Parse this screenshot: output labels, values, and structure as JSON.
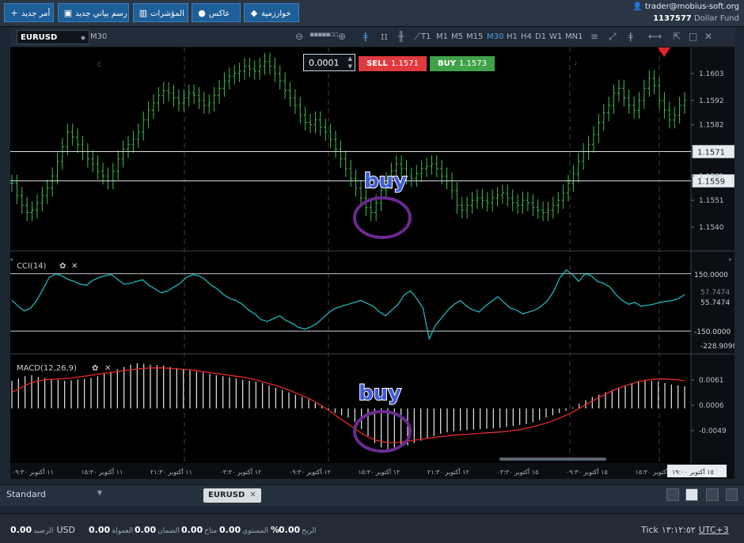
{
  "toolbar": {
    "buttons": [
      {
        "label": "أمر جديد",
        "icon": "plus-icon"
      },
      {
        "label": "رسم بياني جديد",
        "icon": "chart-icon"
      },
      {
        "label": "المؤشرات",
        "icon": "indicators-icon"
      },
      {
        "label": "عاكس",
        "icon": "people-icon"
      },
      {
        "label": "خوارزمية",
        "icon": "diamond-icon"
      }
    ]
  },
  "account": {
    "user": "trader@mobius-soft.org",
    "number": "1137577",
    "currency": "Dollar Fund"
  },
  "chart_header": {
    "symbol": "EURUSD",
    "timeframe": "M30",
    "timeframes": [
      "T1",
      "M1",
      "M5",
      "M15",
      "M30",
      "H1",
      "H4",
      "D1",
      "W1",
      "MN1"
    ],
    "active_timeframe": "M30"
  },
  "trade": {
    "quantity": "0.0001",
    "sell_label": "SELL",
    "sell_price": "1.1571",
    "buy_label": "BUY",
    "buy_price": "1.1573"
  },
  "annotations": {
    "buy1": "buy",
    "buy2": "buy"
  },
  "price_axis": {
    "ticks": [
      "1.1603",
      "1.1592",
      "1.1582",
      "1.1561",
      "1.1551",
      "1.1540"
    ],
    "line_labels": [
      "1.1571",
      "1.1559"
    ]
  },
  "cci": {
    "title": "CCI(14)",
    "levels": [
      "150.0000",
      "-150.0000"
    ],
    "values": [
      "57.7474",
      "55.7474",
      "-228.9098"
    ]
  },
  "macd": {
    "title": "MACD(12,26,9)",
    "ticks": [
      "0.0061",
      "0.0006",
      "-0.0049"
    ]
  },
  "time_axis": {
    "labels": [
      "١١ أكتوبر ٠٩:٣٠",
      "١١ أكتوبر ١٥:٣٠",
      "١١ أكتوبر ٢١:٣٠",
      "١٢ أكتوبر ٠٣:٣٠",
      "١٢ أكتوبر ٠٩:٣٠",
      "١٢ أكتوبر ١٥:٣٠",
      "١٢ أكتوبر ٢١:٣٠",
      "١٥ أكتوبر ٠٣:٣٠",
      "١٥ أكتوبر ٠٩:٣٠",
      "١٥ أكتوبر ١٥:٣٠"
    ],
    "current": "١٥ أكتوبر ١٩:٠٠"
  },
  "tabbar": {
    "workspace": "Standard",
    "tab": "EURUSD"
  },
  "status": {
    "balance_value": "0.00",
    "balance_label": "الرصيد",
    "currency": "USD",
    "commission_value": "0.00",
    "commission_label": "العمولة",
    "margin_value": "0.00",
    "margin_label": "الضمان",
    "free_value": "0.00",
    "free_label": "متاح",
    "level_value": "0.00",
    "level_label": "المستوى",
    "level_unit": "%",
    "profit_value": "0.00",
    "profit_label": "الربح",
    "mode": "Tick",
    "time": "١٣:١٢:٥٢",
    "timezone": "UTC+3"
  },
  "colors": {
    "bull": "#3fbf4a",
    "cci_line": "#1fb5b8",
    "signal": "#e22b2b",
    "annotation_circle": "#6a2a8f",
    "annotation_text": "#3f5bd8"
  }
}
